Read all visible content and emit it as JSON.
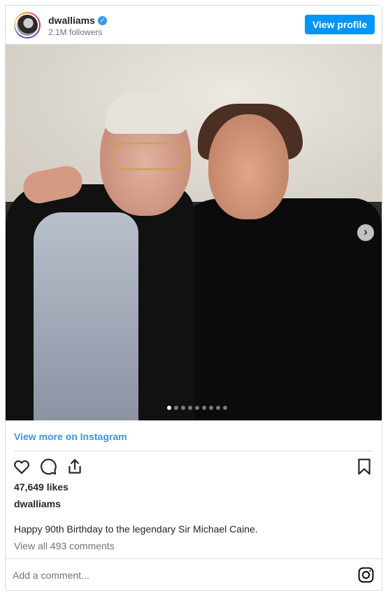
{
  "header": {
    "username": "dwalliams",
    "verified_mark": "✓",
    "followers": "2.1M followers",
    "view_profile_label": "View profile"
  },
  "media": {
    "next_arrow": "›",
    "slide_count": 9,
    "active_slide": 1
  },
  "footer": {
    "view_more_label": "View more on Instagram",
    "likes": "47,649 likes",
    "author": "dwalliams",
    "caption": "Happy 90th Birthday to the legendary Sir Michael Caine.",
    "comments_link": "View all 493 comments",
    "comment_placeholder": "Add a comment..."
  },
  "icons": [
    "heart-icon",
    "comment-icon",
    "share-icon",
    "bookmark-icon",
    "instagram-icon",
    "verified-badge-icon",
    "chevron-right-icon"
  ],
  "colors": {
    "accent": "#0095f6",
    "link": "#3897f0",
    "muted": "#737373",
    "border": "#dbdbdb"
  }
}
